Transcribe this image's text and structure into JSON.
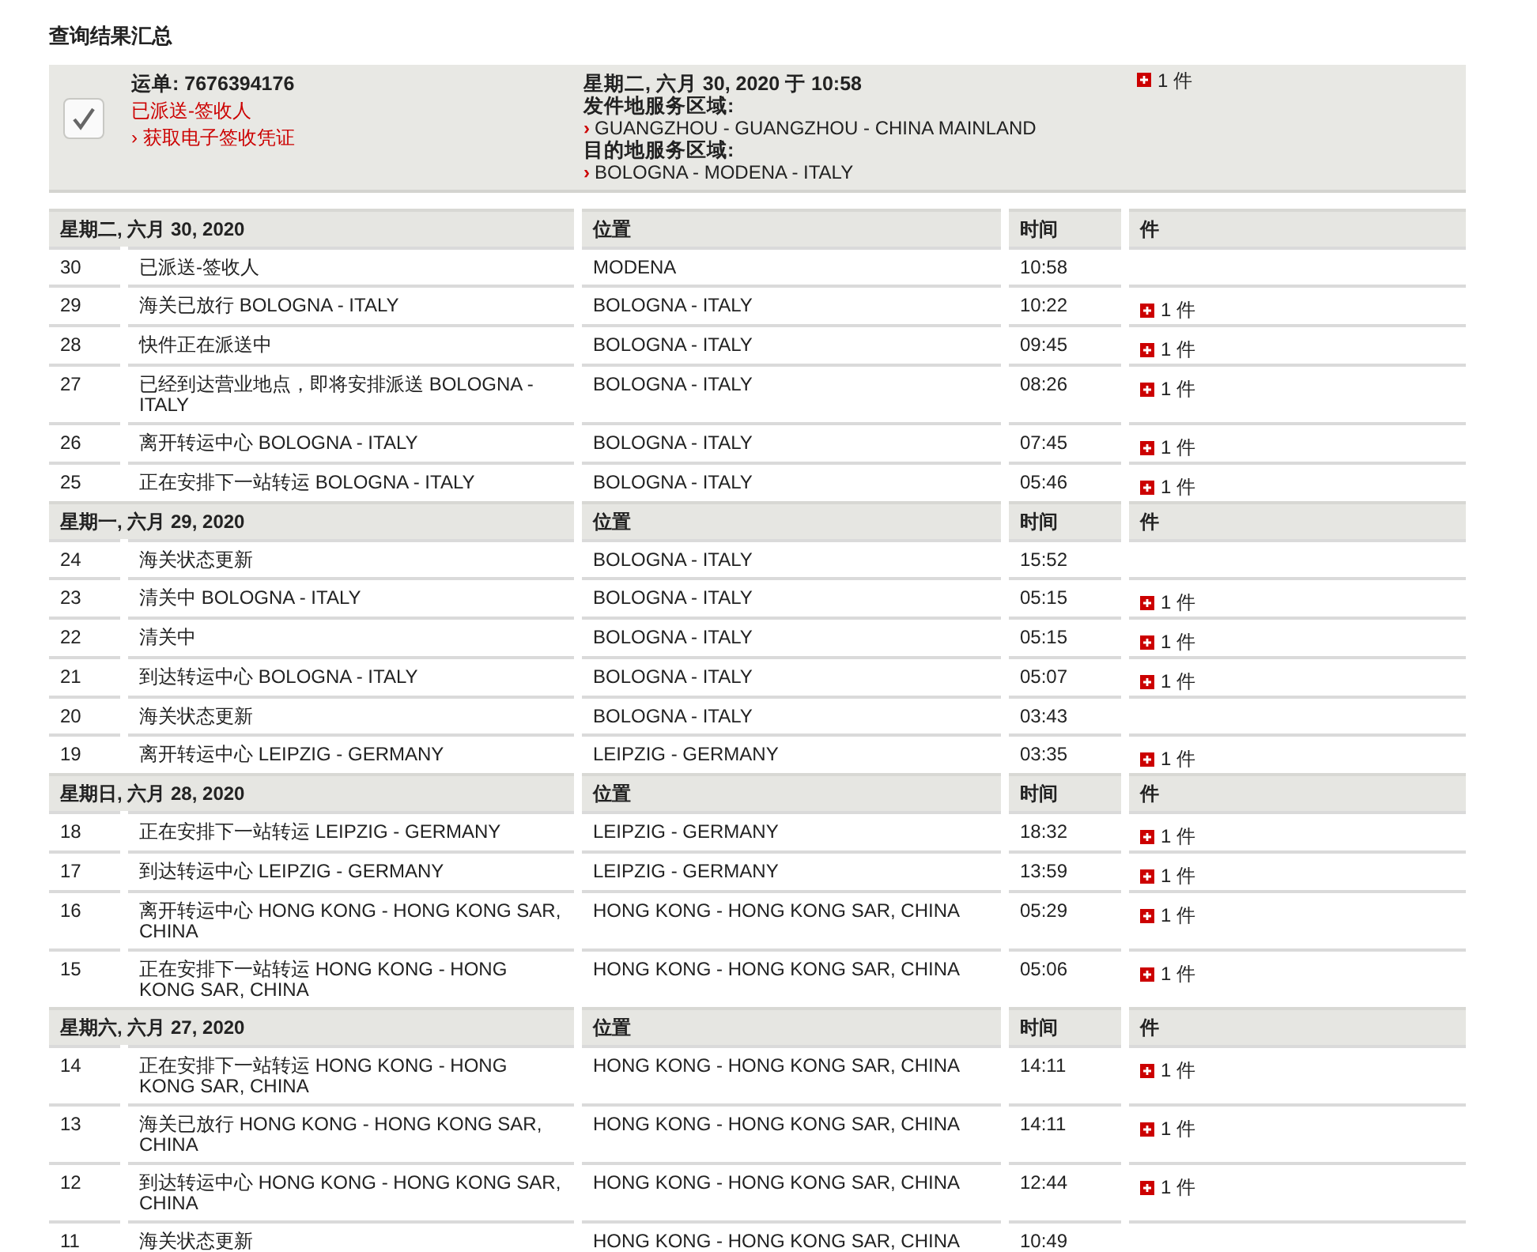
{
  "title": "查询结果汇总",
  "summary": {
    "waybill": "运单: 7676394176",
    "checked": true,
    "status": "已派送-签收人",
    "proof_link_marker": "›",
    "proof_link": "获取电子签收凭证",
    "area_marker": "›",
    "datetime": "星期二, 六月 30, 2020 于 10:58",
    "origin_label": "发件地服务区域:",
    "origin": "GUANGZHOU - GUANGZHOU - CHINA MAINLAND",
    "destination_label": "目的地服务区域:",
    "destination": "BOLOGNA - MODENA - ITALY",
    "pieces": "1 件"
  },
  "days": [
    {
      "date": "星期二, 六月 30, 2020",
      "location_header": "位置",
      "time_header": "时间",
      "pieces_header": "件",
      "events": [
        {
          "no": "30",
          "description": "已派送-签收人",
          "location": "MODENA",
          "time": "10:58"
        },
        {
          "no": "29",
          "description": "海关已放行 BOLOGNA - ITALY",
          "location": "BOLOGNA - ITALY",
          "time": "10:22",
          "pieces": "1 件"
        },
        {
          "no": "28",
          "description": "快件正在派送中",
          "location": "BOLOGNA - ITALY",
          "time": "09:45",
          "pieces": "1 件"
        },
        {
          "no": "27",
          "description": "已经到达营业地点，即将安排派送 BOLOGNA - ITALY",
          "location": "BOLOGNA - ITALY",
          "time": "08:26",
          "pieces": "1 件"
        },
        {
          "no": "26",
          "description": "离开转运中心 BOLOGNA - ITALY",
          "location": "BOLOGNA - ITALY",
          "time": "07:45",
          "pieces": "1 件"
        },
        {
          "no": "25",
          "description": "正在安排下一站转运 BOLOGNA - ITALY",
          "location": "BOLOGNA - ITALY",
          "time": "05:46",
          "pieces": "1 件"
        }
      ]
    },
    {
      "date": "星期一, 六月 29, 2020",
      "location_header": "位置",
      "time_header": "时间",
      "pieces_header": "件",
      "events": [
        {
          "no": "24",
          "description": "海关状态更新",
          "location": "BOLOGNA - ITALY",
          "time": "15:52"
        },
        {
          "no": "23",
          "description": "清关中 BOLOGNA - ITALY",
          "location": "BOLOGNA - ITALY",
          "time": "05:15",
          "pieces": "1 件"
        },
        {
          "no": "22",
          "description": "清关中",
          "location": "BOLOGNA - ITALY",
          "time": "05:15",
          "pieces": "1 件"
        },
        {
          "no": "21",
          "description": "到达转运中心 BOLOGNA - ITALY",
          "location": "BOLOGNA - ITALY",
          "time": "05:07",
          "pieces": "1 件"
        },
        {
          "no": "20",
          "description": "海关状态更新",
          "location": "BOLOGNA - ITALY",
          "time": "03:43"
        },
        {
          "no": "19",
          "description": "离开转运中心 LEIPZIG - GERMANY",
          "location": "LEIPZIG - GERMANY",
          "time": "03:35",
          "pieces": "1 件"
        }
      ]
    },
    {
      "date": "星期日, 六月 28, 2020",
      "location_header": "位置",
      "time_header": "时间",
      "pieces_header": "件",
      "events": [
        {
          "no": "18",
          "description": "正在安排下一站转运 LEIPZIG - GERMANY",
          "location": "LEIPZIG - GERMANY",
          "time": "18:32",
          "pieces": "1 件"
        },
        {
          "no": "17",
          "description": "到达转运中心 LEIPZIG - GERMANY",
          "location": "LEIPZIG - GERMANY",
          "time": "13:59",
          "pieces": "1 件"
        },
        {
          "no": "16",
          "description": "离开转运中心 HONG KONG - HONG KONG SAR, CHINA",
          "location": "HONG KONG - HONG KONG SAR, CHINA",
          "time": "05:29",
          "pieces": "1 件"
        },
        {
          "no": "15",
          "description": "正在安排下一站转运 HONG KONG - HONG KONG SAR, CHINA",
          "location": "HONG KONG - HONG KONG SAR, CHINA",
          "time": "05:06",
          "pieces": "1 件"
        }
      ]
    },
    {
      "date": "星期六, 六月 27, 2020",
      "location_header": "位置",
      "time_header": "时间",
      "pieces_header": "件",
      "events": [
        {
          "no": "14",
          "description": "正在安排下一站转运 HONG KONG - HONG KONG SAR, CHINA",
          "location": "HONG KONG - HONG KONG SAR, CHINA",
          "time": "14:11",
          "pieces": "1 件"
        },
        {
          "no": "13",
          "description": "海关已放行 HONG KONG - HONG KONG SAR, CHINA",
          "location": "HONG KONG - HONG KONG SAR, CHINA",
          "time": "14:11",
          "pieces": "1 件"
        },
        {
          "no": "12",
          "description": "到达转运中心 HONG KONG - HONG KONG SAR, CHINA",
          "location": "HONG KONG - HONG KONG SAR, CHINA",
          "time": "12:44",
          "pieces": "1 件"
        },
        {
          "no": "11",
          "description": "海关状态更新",
          "location": "HONG KONG - HONG KONG SAR, CHINA",
          "time": "10:49"
        }
      ]
    }
  ]
}
